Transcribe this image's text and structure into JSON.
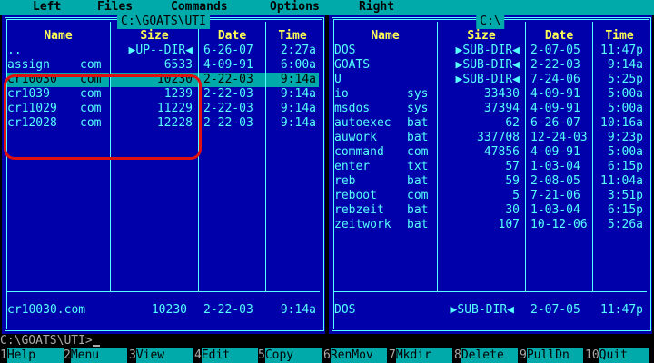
{
  "menubar": {
    "items": [
      "Left",
      "Files",
      "Commands",
      "Options",
      "Right"
    ]
  },
  "left_panel": {
    "path": "C:\\GOATS\\UTI",
    "headers": [
      "Name",
      "Size",
      "Date",
      "Time"
    ],
    "rows": [
      {
        "name": "..",
        "ext": "",
        "size": "▶UP--DIR◀",
        "date": "6-26-07",
        "time": "2:27a",
        "selected": false
      },
      {
        "name": "assign",
        "ext": "com",
        "size": "6533",
        "date": "4-09-91",
        "time": "6:00a",
        "selected": false
      },
      {
        "name": "cr10030",
        "ext": "com",
        "size": "10230",
        "date": "2-22-03",
        "time": "9:14a",
        "selected": true
      },
      {
        "name": "cr1039",
        "ext": "com",
        "size": "1239",
        "date": "2-22-03",
        "time": "9:14a",
        "selected": false
      },
      {
        "name": "cr11029",
        "ext": "com",
        "size": "11229",
        "date": "2-22-03",
        "time": "9:14a",
        "selected": false
      },
      {
        "name": "cr12028",
        "ext": "com",
        "size": "12228",
        "date": "2-22-03",
        "time": "9:14a",
        "selected": false
      }
    ],
    "footer": {
      "name": "cr10030.com",
      "size": "10230",
      "date": "2-22-03",
      "time": "9:14a"
    }
  },
  "right_panel": {
    "path": "C:\\",
    "headers": [
      "Name",
      "Size",
      "Date",
      "Time"
    ],
    "rows": [
      {
        "name": "DOS",
        "ext": "",
        "size": "▶SUB-DIR◀",
        "date": "2-07-05",
        "time": "11:47p"
      },
      {
        "name": "GOATS",
        "ext": "",
        "size": "▶SUB-DIR◀",
        "date": "2-22-03",
        "time": "9:14a"
      },
      {
        "name": "U",
        "ext": "",
        "size": "▶SUB-DIR◀",
        "date": "7-24-06",
        "time": "5:25p"
      },
      {
        "name": "io",
        "ext": "sys",
        "size": "33430",
        "date": "4-09-91",
        "time": "5:00a"
      },
      {
        "name": "msdos",
        "ext": "sys",
        "size": "37394",
        "date": "4-09-91",
        "time": "5:00a"
      },
      {
        "name": "autoexec",
        "ext": "bat",
        "size": "62",
        "date": "6-26-07",
        "time": "10:16a"
      },
      {
        "name": "auwork",
        "ext": "bat",
        "size": "337708",
        "date": "12-24-03",
        "time": "9:23p"
      },
      {
        "name": "command",
        "ext": "com",
        "size": "47856",
        "date": "4-09-91",
        "time": "5:00a"
      },
      {
        "name": "enter",
        "ext": "txt",
        "size": "57",
        "date": "1-03-04",
        "time": "6:15p"
      },
      {
        "name": "reb",
        "ext": "bat",
        "size": "59",
        "date": "2-08-05",
        "time": "11:04a"
      },
      {
        "name": "reboot",
        "ext": "com",
        "size": "5",
        "date": "7-21-06",
        "time": "3:51p"
      },
      {
        "name": "rebzeit",
        "ext": "bat",
        "size": "30",
        "date": "1-03-04",
        "time": "6:15p"
      },
      {
        "name": "zeitwork",
        "ext": "bat",
        "size": "107",
        "date": "10-12-06",
        "time": "5:26a"
      }
    ],
    "footer": {
      "name": "DOS",
      "size": "▶SUB-DIR◀",
      "date": "2-07-05",
      "time": "11:47p"
    }
  },
  "command_line": {
    "prompt": "C:\\GOATS\\UTI>"
  },
  "fkeys": [
    {
      "num": "1",
      "label": "Help"
    },
    {
      "num": "2",
      "label": "Menu"
    },
    {
      "num": "3",
      "label": "View"
    },
    {
      "num": "4",
      "label": "Edit"
    },
    {
      "num": "5",
      "label": "Copy"
    },
    {
      "num": "6",
      "label": "RenMov"
    },
    {
      "num": "7",
      "label": "Mkdir"
    },
    {
      "num": "8",
      "label": "Delete"
    },
    {
      "num": "9",
      "label": "PullDn"
    },
    {
      "num": "10",
      "label": "Quit"
    }
  ],
  "colors": {
    "panel_bg": "#0000aa",
    "text": "#55ffff",
    "header": "#ffff55",
    "bar": "#00aaaa",
    "annotation": "#e01010"
  }
}
